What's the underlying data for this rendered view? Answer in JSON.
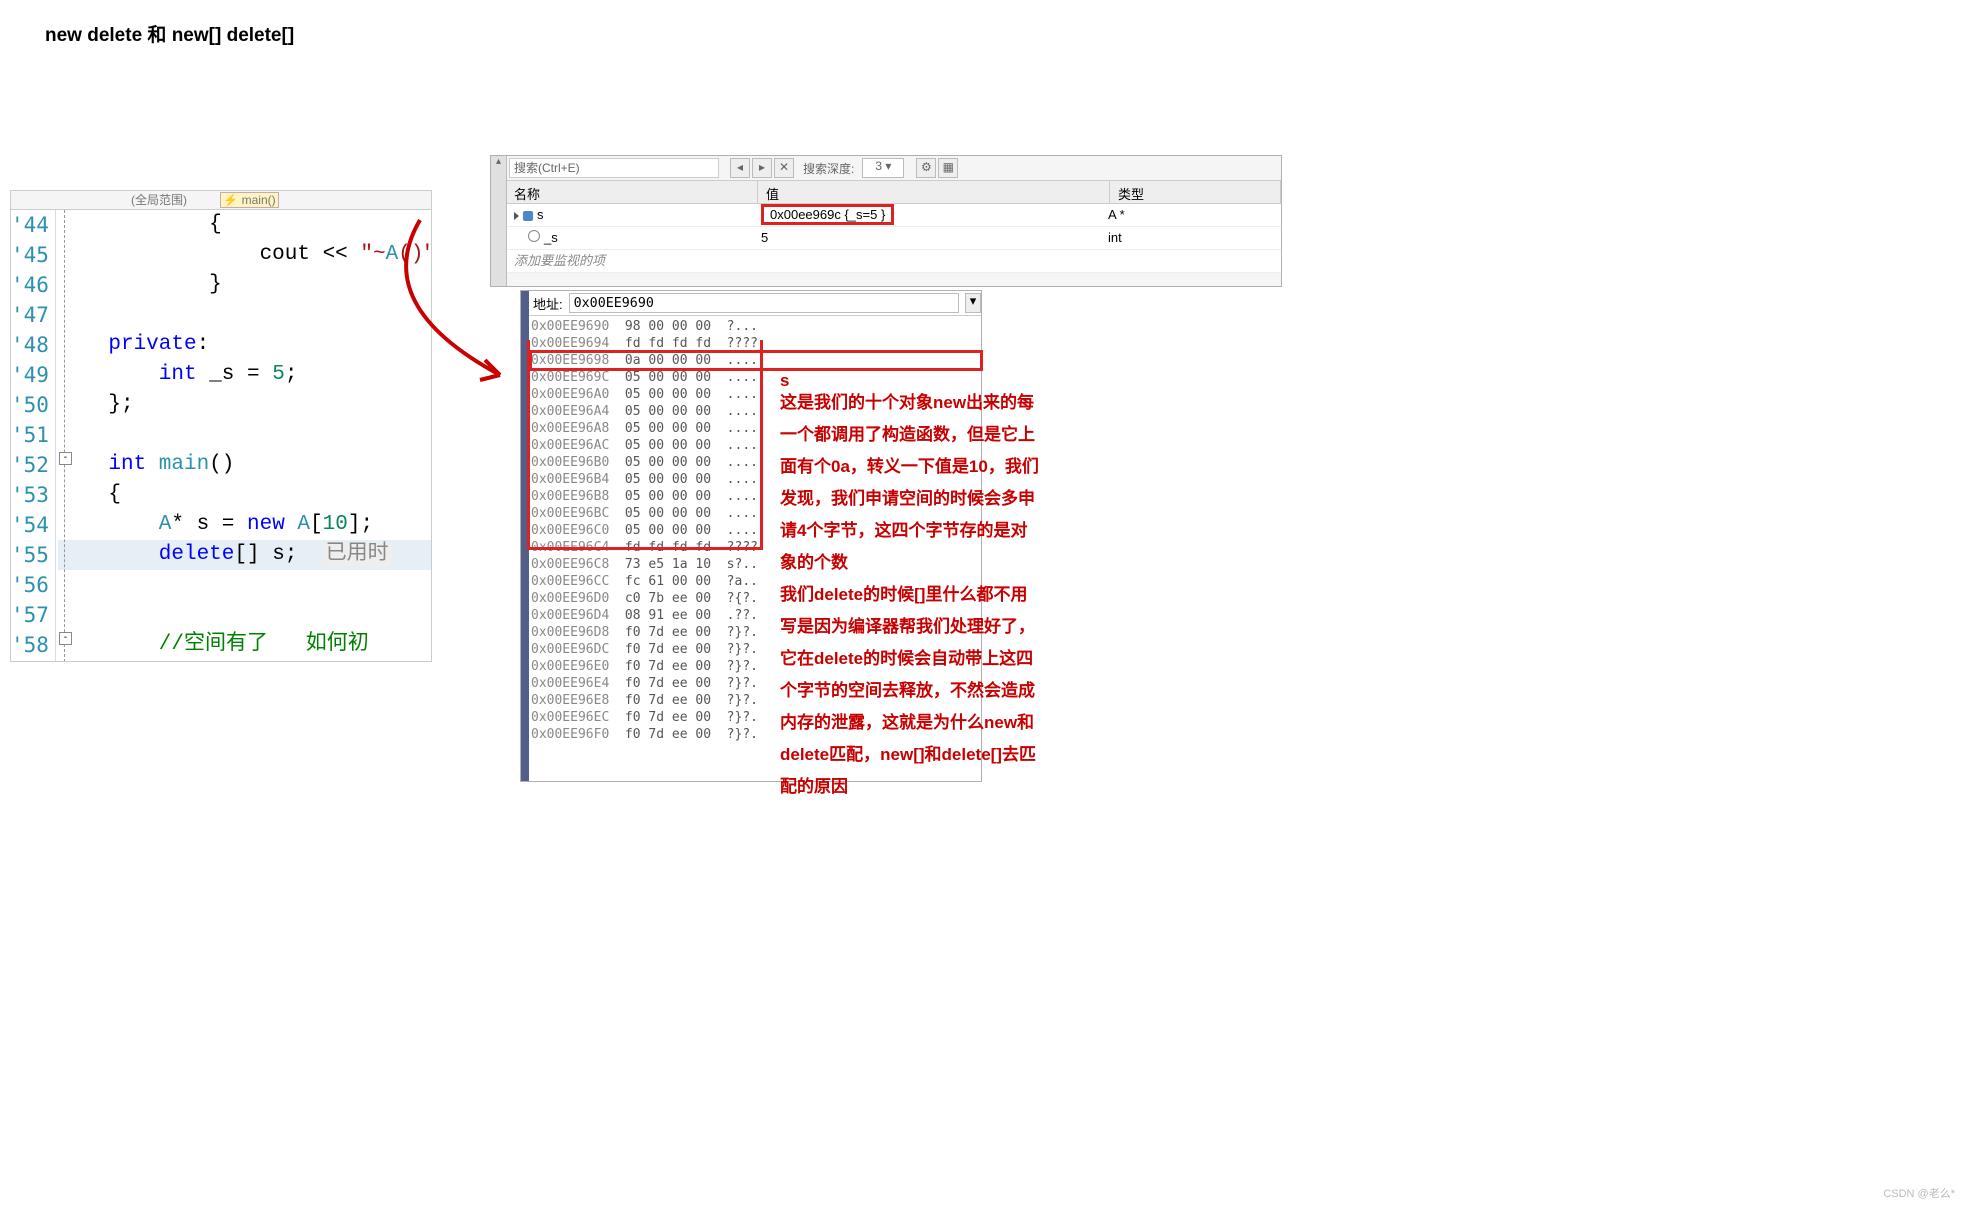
{
  "title": "new delete 和 new[] delete[]",
  "editor": {
    "header_scope": "(全局范围)",
    "header_func": "main()",
    "lines_start": 44,
    "lines_end": 58,
    "code": [
      "            {",
      "                cout << \"~A()\"",
      "            }",
      "",
      "    private:",
      "        int _s = 5;",
      "    };",
      "",
      "    int main()",
      "    {",
      "        A* s = new A[10];",
      "        delete[] s;  已用时",
      "",
      "",
      "        //空间有了   如何初"
    ]
  },
  "watch": {
    "search_placeholder": "搜索(Ctrl+E)",
    "depth_label": "搜索深度:",
    "depth_value": "3",
    "cols": {
      "name": "名称",
      "value": "值",
      "type": "类型"
    },
    "rows": [
      {
        "name": "s",
        "value": "0x00ee969c {_s=5 }",
        "type": "A *"
      },
      {
        "name": "_s",
        "value": "5",
        "type": "int"
      }
    ],
    "add_hint": "添加要监视的项"
  },
  "memory": {
    "addr_label": "地址:",
    "addr_value": "0x00EE9690",
    "rows": [
      {
        "a": "0x00EE9690",
        "h": "98 00 00 00",
        "s": "?..."
      },
      {
        "a": "0x00EE9694",
        "h": "fd fd fd fd",
        "s": "????"
      },
      {
        "a": "0x00EE9698",
        "h": "0a 00 00 00",
        "s": "...."
      },
      {
        "a": "0x00EE969C",
        "h": "05 00 00 00",
        "s": "...."
      },
      {
        "a": "0x00EE96A0",
        "h": "05 00 00 00",
        "s": "...."
      },
      {
        "a": "0x00EE96A4",
        "h": "05 00 00 00",
        "s": "...."
      },
      {
        "a": "0x00EE96A8",
        "h": "05 00 00 00",
        "s": "...."
      },
      {
        "a": "0x00EE96AC",
        "h": "05 00 00 00",
        "s": "...."
      },
      {
        "a": "0x00EE96B0",
        "h": "05 00 00 00",
        "s": "...."
      },
      {
        "a": "0x00EE96B4",
        "h": "05 00 00 00",
        "s": "...."
      },
      {
        "a": "0x00EE96B8",
        "h": "05 00 00 00",
        "s": "...."
      },
      {
        "a": "0x00EE96BC",
        "h": "05 00 00 00",
        "s": "...."
      },
      {
        "a": "0x00EE96C0",
        "h": "05 00 00 00",
        "s": "...."
      },
      {
        "a": "0x00EE96C4",
        "h": "fd fd fd fd",
        "s": "????"
      },
      {
        "a": "0x00EE96C8",
        "h": "73 e5 1a 10",
        "s": "s?.."
      },
      {
        "a": "0x00EE96CC",
        "h": "fc 61 00 00",
        "s": "?a.."
      },
      {
        "a": "0x00EE96D0",
        "h": "c0 7b ee 00",
        "s": "?{?."
      },
      {
        "a": "0x00EE96D4",
        "h": "08 91 ee 00",
        "s": ".??."
      },
      {
        "a": "0x00EE96D8",
        "h": "f0 7d ee 00",
        "s": "?}?."
      },
      {
        "a": "0x00EE96DC",
        "h": "f0 7d ee 00",
        "s": "?}?."
      },
      {
        "a": "0x00EE96E0",
        "h": "f0 7d ee 00",
        "s": "?}?."
      },
      {
        "a": "0x00EE96E4",
        "h": "f0 7d ee 00",
        "s": "?}?."
      },
      {
        "a": "0x00EE96E8",
        "h": "f0 7d ee 00",
        "s": "?}?."
      },
      {
        "a": "0x00EE96EC",
        "h": "f0 7d ee 00",
        "s": "?}?."
      },
      {
        "a": "0x00EE96F0",
        "h": "f0 7d ee 00",
        "s": "?}?."
      }
    ]
  },
  "annotation": {
    "label": "s",
    "text": "这是我们的十个对象new出来的每一个都调用了构造函数，但是它上面有个0a，转义一下值是10，我们发现，我们申请空间的时候会多申请4个字节，这四个字节存的是对象的个数\n我们delete的时候[]里什么都不用写是因为编译器帮我们处理好了，它在delete的时候会自动带上这四个字节的空间去释放，不然会造成内存的泄露，这就是为什么new和delete匹配，new[]和delete[]去匹配的原因"
  },
  "watermark": "CSDN @老么*"
}
